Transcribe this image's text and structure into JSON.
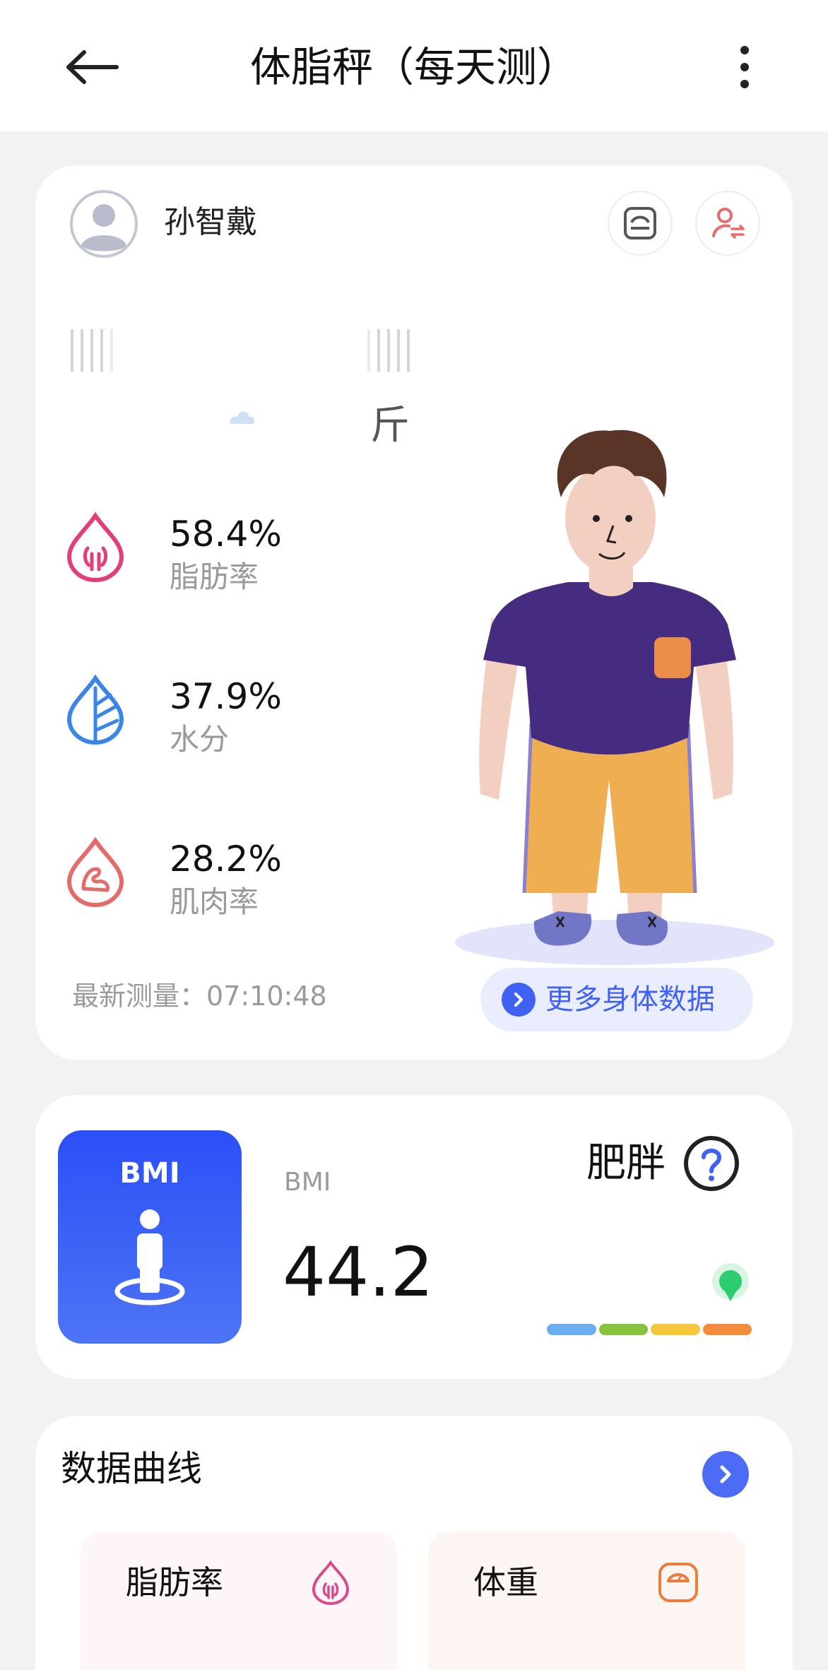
{
  "header": {
    "title": "体脂秤（每天测）"
  },
  "profile": {
    "username": "孙智戴"
  },
  "weight": {
    "unit": "斤"
  },
  "metrics": [
    {
      "value": "58.4%",
      "label": "脂肪率",
      "icon": "fat-drop-icon",
      "color": "#e23f7a"
    },
    {
      "value": "37.9%",
      "label": "水分",
      "icon": "water-leaf-icon",
      "color": "#3a86e8"
    },
    {
      "value": "28.2%",
      "label": "肌肉率",
      "icon": "muscle-drop-icon",
      "color": "#e56a6a"
    }
  ],
  "latest": {
    "text": "最新测量：07:10:48"
  },
  "more_data_button": {
    "label": "更多身体数据"
  },
  "bmi": {
    "tile_label": "BMI",
    "label": "BMI",
    "value": "44.2",
    "status": "肥胖",
    "scale_colors": [
      "#6aaef0",
      "#86c440",
      "#f5c63a",
      "#f28c3c"
    ],
    "indicator_color": "#2ecc71"
  },
  "curve": {
    "title": "数据曲线",
    "cards": [
      {
        "label": "脂肪率",
        "icon": "fat-drop-icon",
        "color": "#d94a8c"
      },
      {
        "label": "体重",
        "icon": "scale-icon",
        "color": "#ea7c3c"
      }
    ]
  },
  "colors": {
    "accent": "#3f61f6",
    "background": "#f2f2f2"
  }
}
